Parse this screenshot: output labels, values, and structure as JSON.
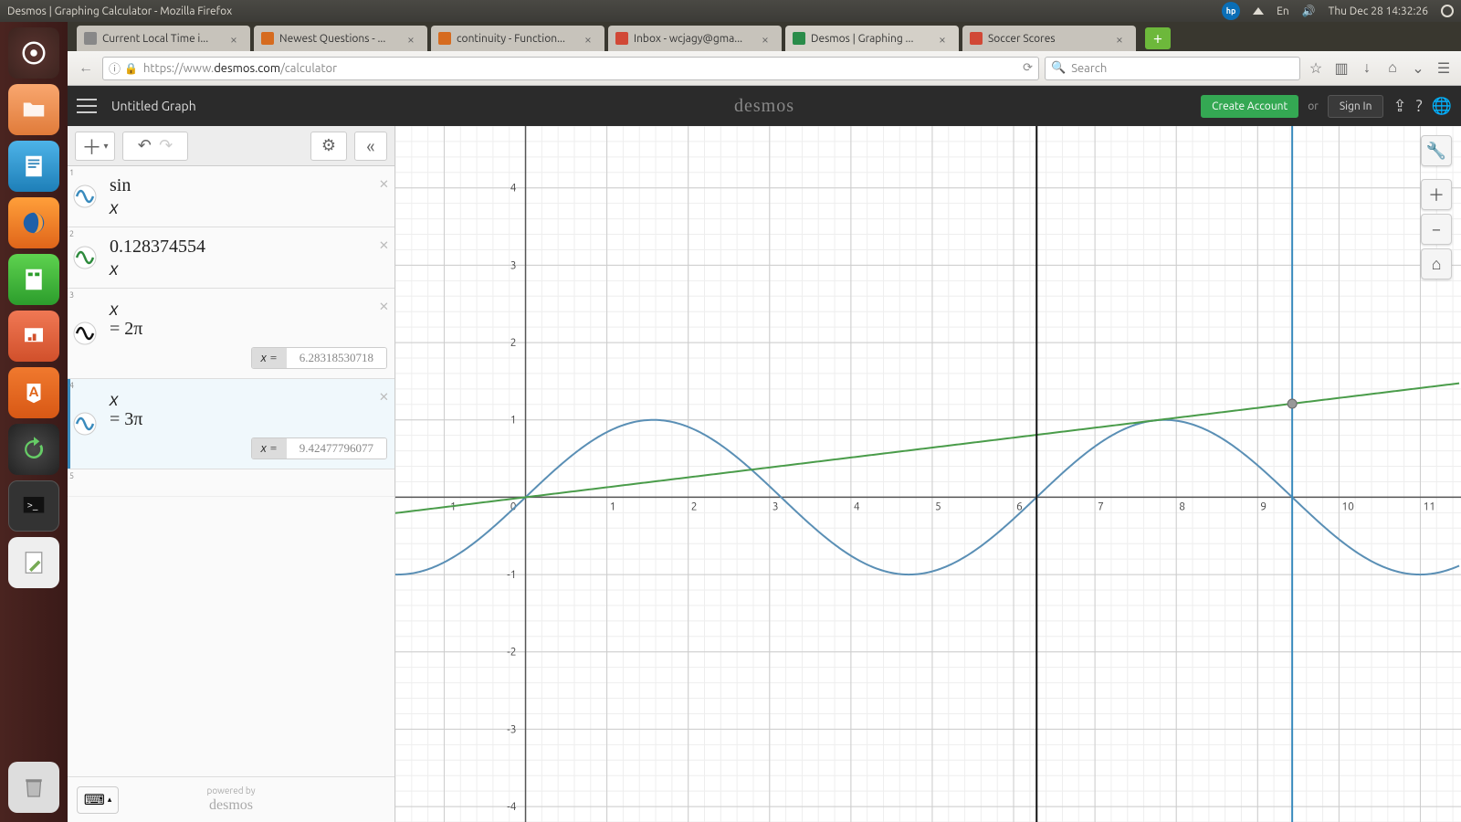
{
  "os": {
    "window_title": "Desmos | Graphing Calculator - Mozilla Firefox",
    "lang": "En",
    "clock": "Thu Dec 28 14:32:26"
  },
  "tabs": [
    {
      "label": "Current Local Time i...",
      "favicon": "#888"
    },
    {
      "label": "Newest Questions - ...",
      "favicon": "#d66b1f"
    },
    {
      "label": "continuity - Function...",
      "favicon": "#d66b1f"
    },
    {
      "label": "Inbox - wcjagy@gma...",
      "favicon": "#d14836"
    },
    {
      "label": "Desmos | Graphing ...",
      "favicon": "#2a8c4a",
      "active": true
    },
    {
      "label": "Soccer Scores",
      "favicon": "#d14836"
    }
  ],
  "url": {
    "prefix": "https://www.",
    "domain": "desmos.com",
    "path": "/calculator"
  },
  "search_placeholder": "Search",
  "desmos": {
    "title": "Untitled Graph",
    "logo": "desmos",
    "create": "Create Account",
    "or": "or",
    "signin": "Sign In"
  },
  "expressions": [
    {
      "idx": "1",
      "formula": "sin x",
      "color": "#3a8bbd",
      "kind": "wave"
    },
    {
      "idx": "2",
      "formula": "0.128374554 x",
      "color": "#2e8b3d",
      "kind": "wave"
    },
    {
      "idx": "3",
      "formula": "x = 2π",
      "color": "#111",
      "kind": "vert",
      "value_label": "x =",
      "value": "6.28318530718"
    },
    {
      "idx": "4",
      "formula": "x = 3π",
      "color": "#3a8bbd",
      "kind": "vert",
      "value_label": "x =",
      "value": "9.42477796077",
      "selected": true
    }
  ],
  "empty_idx": "5",
  "footer": {
    "powered": "powered by",
    "brand": "desmos"
  },
  "chart_data": {
    "type": "line",
    "title": "",
    "xlabel": "",
    "ylabel": "",
    "xlim": [
      -1.6,
      11.5
    ],
    "ylim": [
      -4.2,
      4.8
    ],
    "series": [
      {
        "name": "sin x",
        "kind": "function",
        "expr": "Math.sin(x)",
        "color": "#5a8fb5"
      },
      {
        "name": "0.128374554 x",
        "kind": "function",
        "expr": "0.128374554*x",
        "color": "#4a9c4a"
      },
      {
        "name": "x=2π",
        "kind": "vline",
        "x": 6.28318530718,
        "color": "#111"
      },
      {
        "name": "x=3π",
        "kind": "vline",
        "x": 9.42477796077,
        "color": "#3a8bbd"
      }
    ],
    "intersection": {
      "x": 9.42477796077,
      "y": 1.209,
      "color": "#888"
    }
  }
}
